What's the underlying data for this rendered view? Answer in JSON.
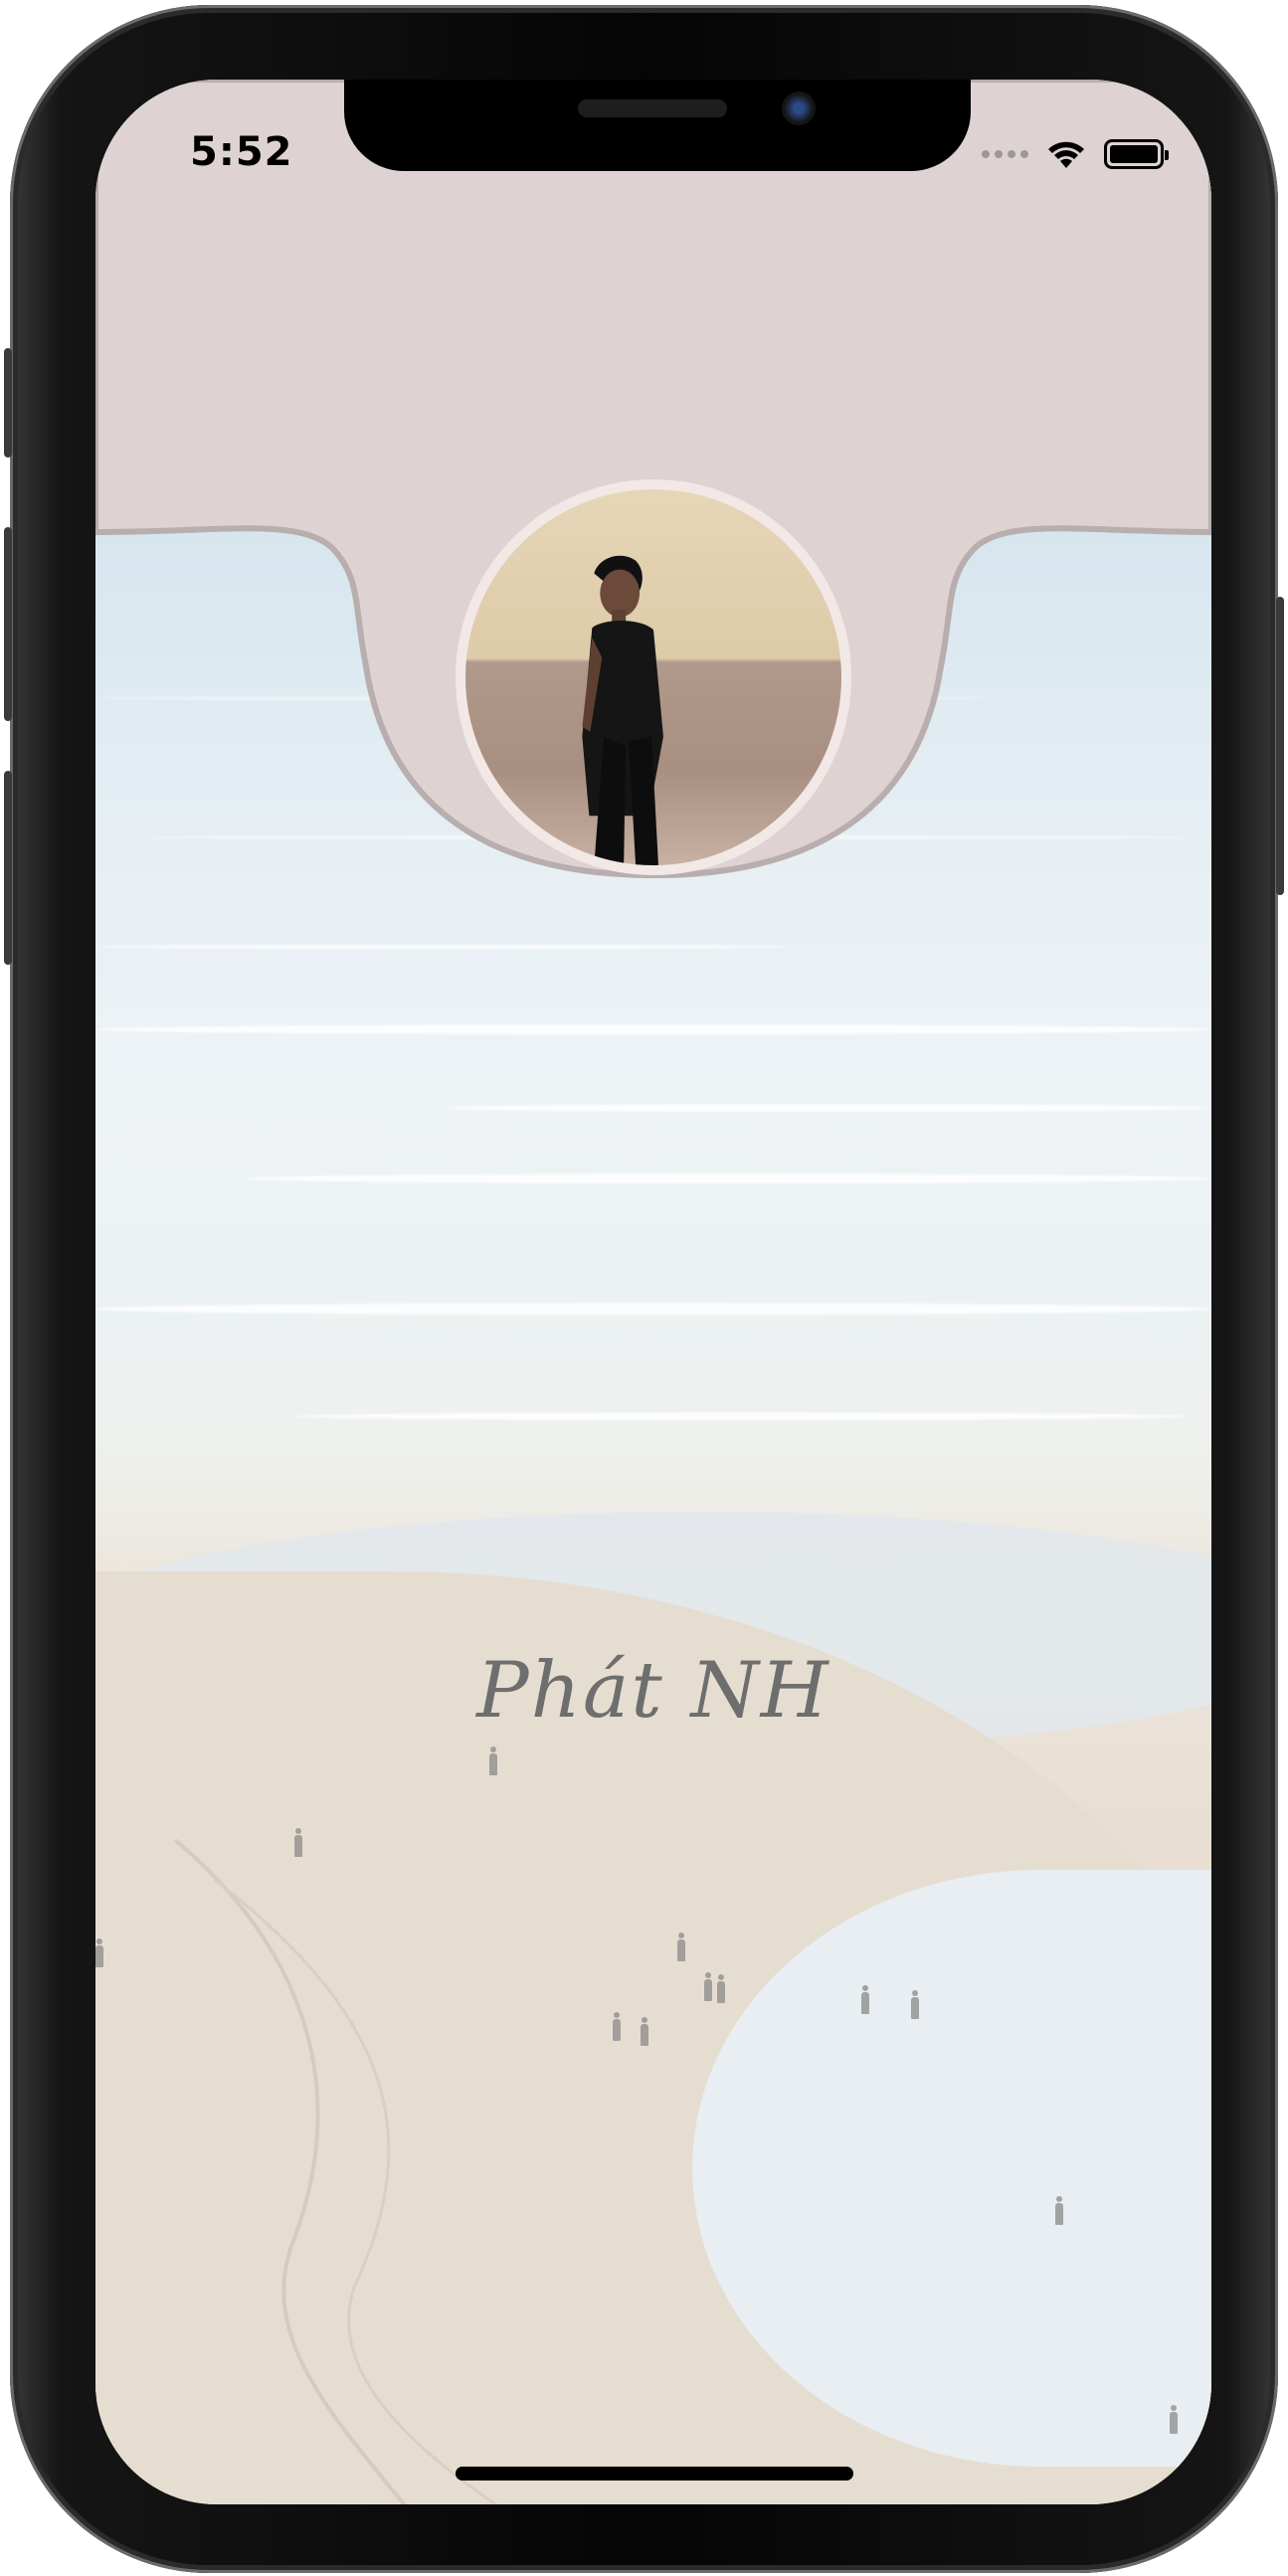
{
  "status_bar": {
    "time": "5:52",
    "icons": [
      "signal-dots-icon",
      "wifi-icon",
      "battery-icon"
    ]
  },
  "profile": {
    "name": "Phát NH",
    "avatar": "profile-photo"
  },
  "colors": {
    "header_background": "#dfd2d2",
    "header_border": "#b8aeae",
    "avatar_ring": "#f2e8e6",
    "name_text": "#6e6e6e"
  }
}
